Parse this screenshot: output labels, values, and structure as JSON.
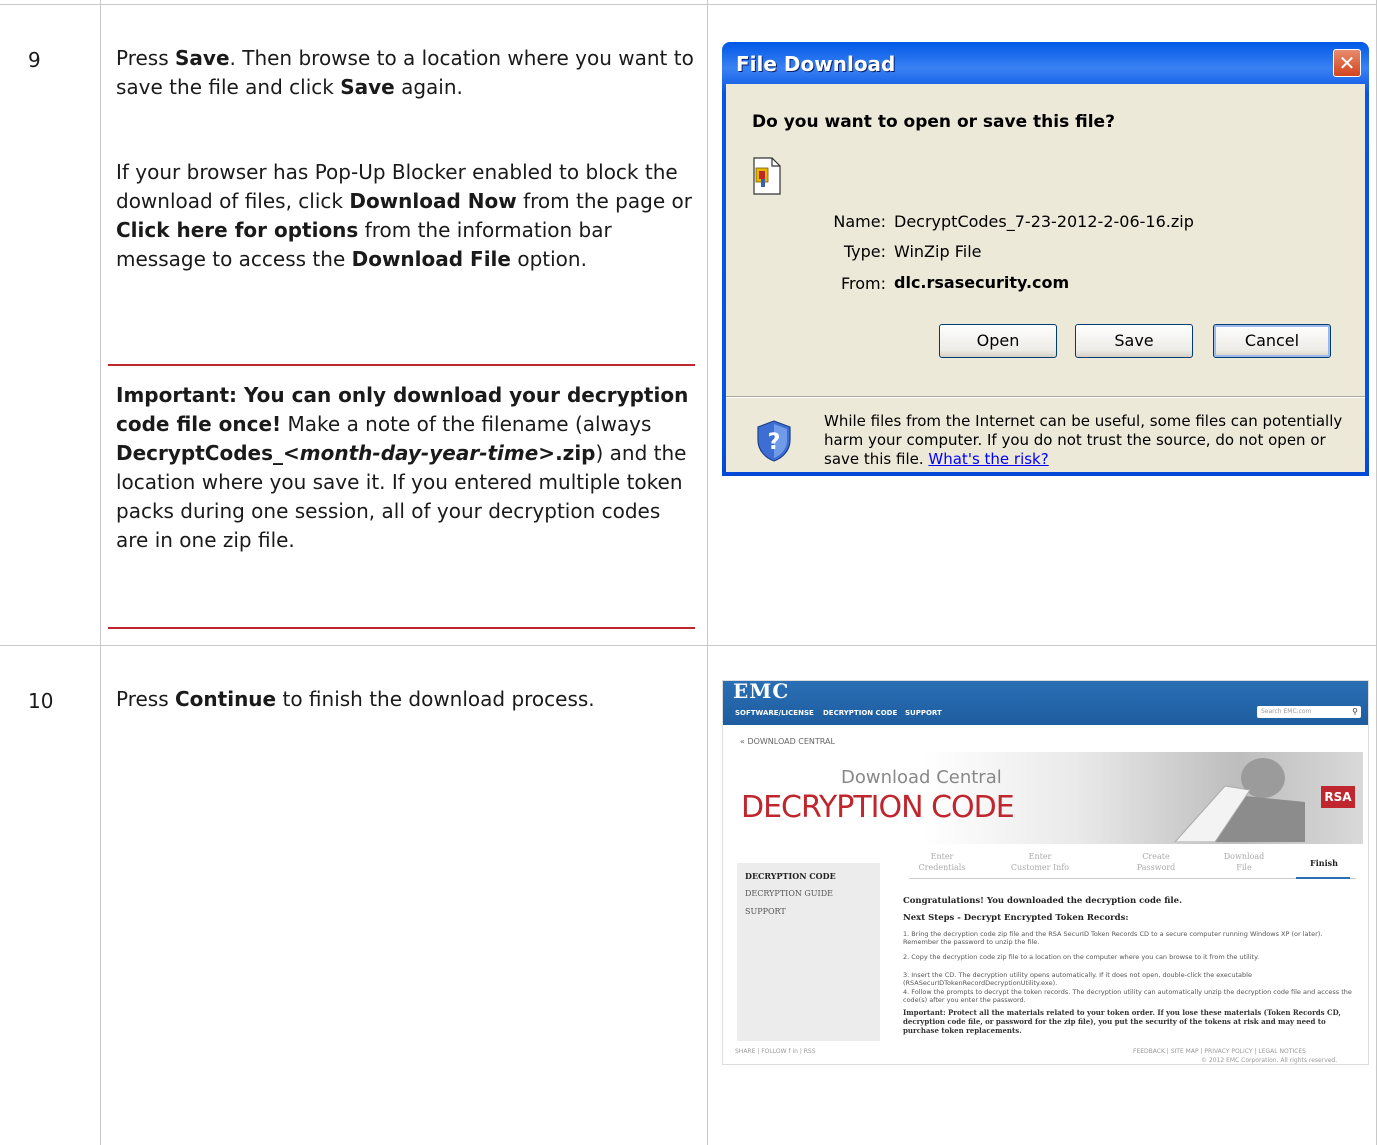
{
  "steps": [
    {
      "number": "9",
      "para1_pre": "Press ",
      "para1_b1": "Save",
      "para1_mid": ". Then browse to a location where you want to save the file and click ",
      "para1_b2": "Save",
      "para1_post": " again.",
      "para2_pre": "If your browser has Pop-Up Blocker enabled to block the download of files, click ",
      "para2_b1": "Download Now",
      "para2_mid1": " from the page or ",
      "para2_b2": "Click here for options",
      "para2_mid2": " from the information bar message to access the ",
      "para2_b3": "Download File",
      "para2_post": " option.",
      "important_b": "Important:  You can only download your decryption code file once!",
      "important_mid": " Make a note of the filename (always ",
      "important_fname1": "DecryptCodes_",
      "important_fname2": "<month-day-year-time>",
      "important_fname3": ".zip",
      "important_post": ") and the location where you save it. If you entered multiple token packs during one session, all of your decryption codes are in one zip file."
    },
    {
      "number": "10",
      "para1_pre": "Press ",
      "para1_b1": "Continue",
      "para1_post": " to finish the download process."
    }
  ],
  "dialog": {
    "title": "File Download",
    "close_glyph": "✕",
    "question": "Do you want to open or save this file?",
    "name_label": "Name:",
    "name_value": "DecryptCodes_7-23-2012-2-06-16.zip",
    "type_label": "Type:",
    "type_value": "WinZip File",
    "from_label": "From:",
    "from_value": "dlc.rsasecurity.com",
    "buttons": [
      "Open",
      "Save",
      "Cancel"
    ],
    "warning": "While files from the Internet can be useful, some files can potentially harm your computer. If you do not trust the source, do not open or save this file. ",
    "warning_link": "What's the risk?"
  },
  "emc": {
    "logo": "EMC",
    "nav": [
      "SOFTWARE/LICENSE",
      "DECRYPTION CODE",
      "SUPPORT"
    ],
    "search_placeholder": "Search EMC.com",
    "back_link": "« DOWNLOAD CENTRAL",
    "banner_sub": "Download Central",
    "banner_main": "DECRYPTION CODE",
    "rsa": "RSA",
    "side": [
      "DECRYPTION CODE",
      "DECRYPTION GUIDE",
      "SUPPORT"
    ],
    "wizard_steps": [
      [
        "Enter",
        "Credentials"
      ],
      [
        "Enter",
        "Customer Info"
      ],
      [
        "Create",
        "Password"
      ],
      [
        "Download",
        "File"
      ],
      [
        "Finish",
        ""
      ]
    ],
    "congrats": "Congratulations! You downloaded the decryption code file.",
    "next_steps": "Next Steps - Decrypt Encrypted Token Records:",
    "list": [
      "1.  Bring the decryption code zip file and the RSA SecurID Token Records CD to a secure computer running Windows XP (or later).  Remember the password to unzip the file.",
      "2.  Copy the decryption code zip file to a location on the computer where you can browse to it from the utility.",
      "3.  Insert the CD. The decryption utility opens automatically. If it does not open, double-click the executable (RSASecurIDTokenRecordDecryptionUtility.exe).",
      "4.  Follow the prompts to decrypt the token records. The decryption utility can automatically unzip the decryption code file and access the code(s) after you enter the password."
    ],
    "important": "Important:  Protect all the materials related to your token order.  If you lose these materials (Token Records CD, decryption code file, or password for the zip file), you put the security of the tokens at risk and may need to purchase token replacements.",
    "footer_left": "SHARE  |  FOLLOW  f  in  |  RSS",
    "footer_right": "FEEDBACK  |  SITE MAP  |  PRIVACY POLICY  |  LEGAL NOTICES",
    "footer_copy": "© 2012 EMC Corporation. All rights reserved."
  }
}
